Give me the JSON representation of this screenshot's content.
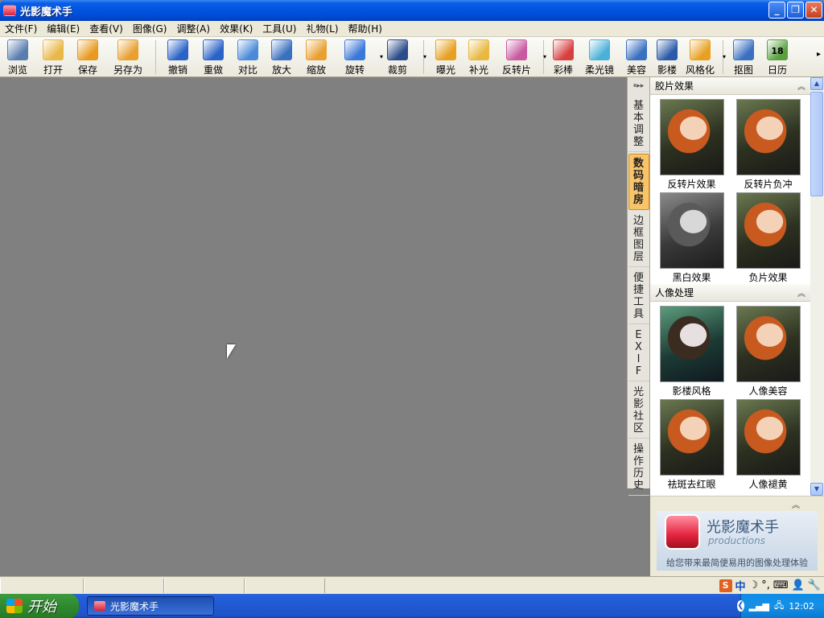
{
  "window": {
    "title": "光影魔术手"
  },
  "menu": [
    "文件(F)",
    "编辑(E)",
    "查看(V)",
    "图像(G)",
    "调整(A)",
    "效果(K)",
    "工具(U)",
    "礼物(L)",
    "帮助(H)"
  ],
  "toolbar": [
    {
      "label": "浏览",
      "icon": "browse-icon",
      "color": "#5a7db0"
    },
    {
      "label": "打开",
      "icon": "folder-open-icon",
      "color": "#e8b848"
    },
    {
      "label": "保存",
      "icon": "save-icon",
      "color": "#e89a20"
    },
    {
      "label": "另存为",
      "icon": "save-as-icon",
      "color": "#e8a030"
    },
    {
      "label": "撤销",
      "icon": "undo-icon",
      "color": "#2a62c8"
    },
    {
      "label": "重做",
      "icon": "redo-icon",
      "color": "#2a62c8"
    },
    {
      "label": "对比",
      "icon": "compare-icon",
      "color": "#4a8ad8"
    },
    {
      "label": "放大",
      "icon": "zoom-in-icon",
      "color": "#3a70c0"
    },
    {
      "label": "缩放",
      "icon": "resize-icon",
      "color": "#e8a030"
    },
    {
      "label": "旋转",
      "icon": "rotate-icon",
      "color": "#3a78d8"
    },
    {
      "label": "裁剪",
      "icon": "crop-icon",
      "color": "#2a4a8a"
    },
    {
      "label": "曝光",
      "icon": "exposure-icon",
      "color": "#e8a020"
    },
    {
      "label": "补光",
      "icon": "fill-light-icon",
      "color": "#e8b840"
    },
    {
      "label": "反转片",
      "icon": "reversal-film-icon",
      "color": "#c85aa0"
    },
    {
      "label": "彩棒",
      "icon": "color-wand-icon",
      "color": "#d84040"
    },
    {
      "label": "柔光镜",
      "icon": "soft-focus-icon",
      "color": "#4ab0d8"
    },
    {
      "label": "美容",
      "icon": "beauty-icon",
      "color": "#3a70c0"
    },
    {
      "label": "影楼",
      "icon": "studio-icon",
      "color": "#2a5aa8"
    },
    {
      "label": "风格化",
      "icon": "stylize-icon",
      "color": "#e8a020"
    },
    {
      "label": "抠图",
      "icon": "cutout-icon",
      "color": "#3a70c0"
    },
    {
      "label": "日历",
      "icon": "calendar-icon",
      "color": "#5aa040",
      "text": "18"
    }
  ],
  "vtabs": [
    {
      "label": "基本调整",
      "active": false
    },
    {
      "label": "数码暗房",
      "active": true
    },
    {
      "label": "边框图层",
      "active": false
    },
    {
      "label": "便捷工具",
      "active": false
    },
    {
      "label": "EXIF",
      "active": false
    },
    {
      "label": "光影社区",
      "active": false
    },
    {
      "label": "操作历史",
      "active": false
    }
  ],
  "panel": {
    "sections": [
      {
        "title": "胶片效果",
        "items": [
          {
            "caption": "反转片效果",
            "style": "orange"
          },
          {
            "caption": "反转片负冲",
            "style": "orange"
          },
          {
            "caption": "黑白效果",
            "style": "gray"
          },
          {
            "caption": "负片效果",
            "style": "orange"
          }
        ]
      },
      {
        "title": "人像处理",
        "items": [
          {
            "caption": "影楼风格",
            "style": "cool"
          },
          {
            "caption": "人像美容",
            "style": "orange"
          },
          {
            "caption": "祛斑去红眼",
            "style": "orange"
          },
          {
            "caption": "人像褪黄",
            "style": "orange"
          }
        ]
      }
    ]
  },
  "brand": {
    "name": "光影魔术手",
    "sub": "productions",
    "slogan": "给您带来最简便易用的图像处理体验"
  },
  "taskbar": {
    "start": "开始",
    "app": "光影魔术手",
    "clock": "12:02"
  },
  "ime": {
    "logo": "S",
    "lang": "中"
  }
}
